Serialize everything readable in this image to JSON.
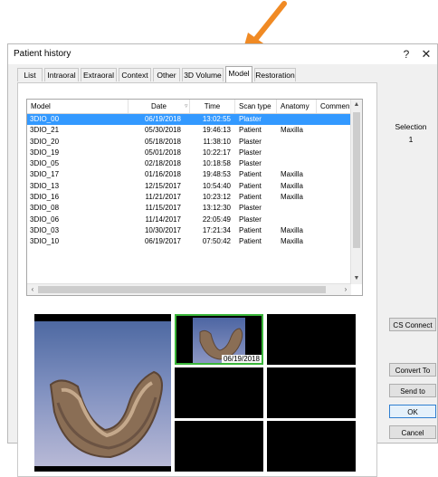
{
  "window": {
    "title": "Patient history",
    "help_label": "?",
    "close_label": "✕"
  },
  "tabs": [
    {
      "label": "List"
    },
    {
      "label": "Intraoral"
    },
    {
      "label": "Extraoral"
    },
    {
      "label": "Context"
    },
    {
      "label": "Other"
    },
    {
      "label": "3D Volume"
    },
    {
      "label": "Model",
      "active": true
    },
    {
      "label": "Restoration"
    }
  ],
  "selection": {
    "label": "Selection",
    "count": "1"
  },
  "table": {
    "columns": [
      "Model",
      "Date",
      "Time",
      "Scan type",
      "Anatomy",
      "Commen"
    ],
    "rows": [
      {
        "model": "3DIO_00",
        "date": "06/19/2018",
        "time": "13:02:55",
        "scan": "Plaster",
        "anatomy": "",
        "selected": true
      },
      {
        "model": "3DIO_21",
        "date": "05/30/2018",
        "time": "19:46:13",
        "scan": "Patient",
        "anatomy": "Maxilla"
      },
      {
        "model": "3DIO_20",
        "date": "05/18/2018",
        "time": "11:38:10",
        "scan": "Plaster",
        "anatomy": ""
      },
      {
        "model": "3DIO_19",
        "date": "05/01/2018",
        "time": "10:22:17",
        "scan": "Plaster",
        "anatomy": ""
      },
      {
        "model": "3DIO_05",
        "date": "02/18/2018",
        "time": "10:18:58",
        "scan": "Plaster",
        "anatomy": ""
      },
      {
        "model": "3DIO_17",
        "date": "01/16/2018",
        "time": "19:48:53",
        "scan": "Patient",
        "anatomy": "Maxilla"
      },
      {
        "model": "3DIO_13",
        "date": "12/15/2017",
        "time": "10:54:40",
        "scan": "Patient",
        "anatomy": "Maxilla"
      },
      {
        "model": "3DIO_16",
        "date": "11/21/2017",
        "time": "10:23:12",
        "scan": "Patient",
        "anatomy": "Maxilla"
      },
      {
        "model": "3DIO_08",
        "date": "11/15/2017",
        "time": "13:12:30",
        "scan": "Plaster",
        "anatomy": ""
      },
      {
        "model": "3DIO_06",
        "date": "11/14/2017",
        "time": "22:05:49",
        "scan": "Plaster",
        "anatomy": ""
      },
      {
        "model": "3DIO_03",
        "date": "10/30/2017",
        "time": "17:21:34",
        "scan": "Patient",
        "anatomy": "Maxilla"
      },
      {
        "model": "3DIO_10",
        "date": "06/19/2017",
        "time": "07:50:42",
        "scan": "Patient",
        "anatomy": "Maxilla"
      }
    ]
  },
  "thumbnail": {
    "date": "06/19/2018"
  },
  "buttons": {
    "cs_connect": "CS Connect",
    "convert_to": "Convert To",
    "send_to": "Send to",
    "ok": "OK",
    "cancel": "Cancel"
  },
  "colors": {
    "accent": "#3399ff",
    "arrow": "#f08a24",
    "thumb_border": "#3ab53a"
  }
}
